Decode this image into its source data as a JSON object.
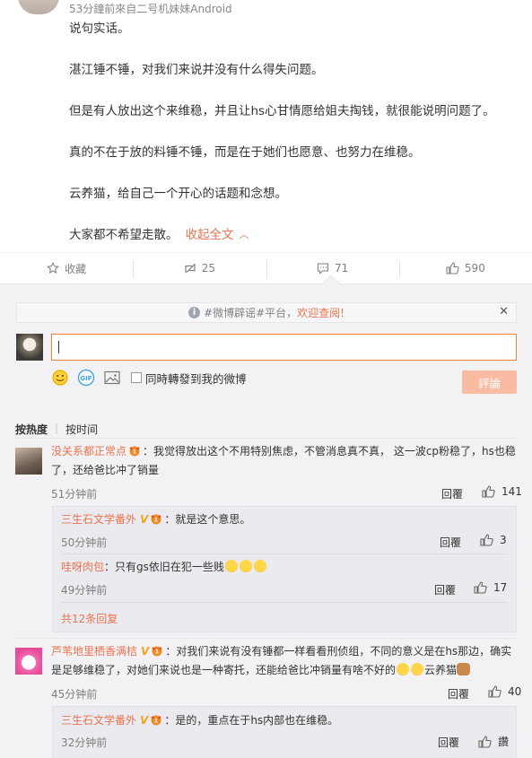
{
  "post": {
    "meta": "53分鐘前來自二号机妹妹Android",
    "paragraphs": [
      "说句实话。",
      "湛江锤不锤，对我们来说并没有什么得失问题。",
      "但是有人放出这个来维稳，并且让hs心甘情愿给姐夫掏钱，就很能说明问题了。",
      "真的不在于放的料锤不锤，而是在于她们也愿意、也努力在维稳。",
      "云养猫，给自己一个开心的话题和念想。",
      "大家都不希望走散。"
    ],
    "collapse_label": "收起全文"
  },
  "actions": {
    "favorite_label": "收藏",
    "repost_count": "25",
    "comment_count": "71",
    "like_count": "590"
  },
  "notice": {
    "text": "#微博辟谣#平台，",
    "link": "欢迎查阅!"
  },
  "composer": {
    "input_value": "",
    "forward_label": "同時轉發到我的微博",
    "submit_label": "評論"
  },
  "sort": {
    "by_hot": "按热度",
    "by_time": "按时间"
  },
  "comments": [
    {
      "name": "没关系都正常点",
      "line1": "：我觉得放出这个不用特别焦虑，不管消息真不真， 这一波cp粉稳了，hs也稳",
      "line2": "了，还给爸比冲了销量",
      "time": "51分钟前",
      "reply": "回覆",
      "likes": "141",
      "replies": [
        {
          "name": "三生石文学番外",
          "text": "：就是这个意思。",
          "time": "50分钟前",
          "reply": "回覆",
          "likes": "3"
        },
        {
          "name": "哇呀肉包",
          "text": "：只有gs依旧在犯一些贱",
          "time": "49分钟前",
          "reply": "回覆",
          "likes": "17"
        }
      ],
      "more": "共12条回复"
    },
    {
      "name": "芦苇地里栖香满桔",
      "line1": "：对我们来说有没有锤都一样看看刑侦组，不同的意义是在hs那边，确实",
      "line2": "是足够维稳了，对她们来说也是一种寄托，还能给爸比冲销量有啥不好的",
      "line2_tail": "云养猫",
      "time": "45分钟前",
      "reply": "回覆",
      "likes": "40",
      "replies": [
        {
          "name": "三生石文学番外",
          "text": "：是的，重点在于hs内部也在维稳。",
          "time": "32分钟前",
          "reply": "回覆",
          "likes": "讚"
        }
      ]
    }
  ],
  "colors": {
    "accent": "#eb7350",
    "input_border": "#fa7d3c",
    "submit_disabled": "#f9bba2",
    "panel_bg": "#f2f2f5"
  }
}
